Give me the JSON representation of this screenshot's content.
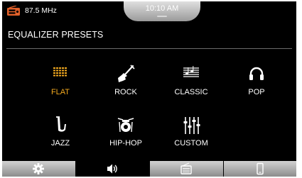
{
  "status": {
    "frequency": "87.5 MHz",
    "time": "10:10 AM",
    "radio_icon": "radio-icon"
  },
  "page": {
    "title": "EQUALIZER PRESETS"
  },
  "presets": [
    {
      "label": "FLAT",
      "icon": "equalizer-bars-icon",
      "selected": true
    },
    {
      "label": "ROCK",
      "icon": "electric-guitar-icon",
      "selected": false
    },
    {
      "label": "CLASSIC",
      "icon": "sheet-music-icon",
      "selected": false
    },
    {
      "label": "POP",
      "icon": "headphones-icon",
      "selected": false
    },
    {
      "label": "JAZZ",
      "icon": "saxophone-icon",
      "selected": false
    },
    {
      "label": "HIP-HOP",
      "icon": "drum-kit-icon",
      "selected": false
    },
    {
      "label": "CUSTOM",
      "icon": "sliders-icon",
      "selected": false
    }
  ],
  "bottom_nav": [
    {
      "icon": "gear-icon"
    },
    {
      "icon": "speaker-icon"
    },
    {
      "icon": "radio-icon"
    },
    {
      "icon": "phone-icon"
    }
  ],
  "colors": {
    "accent": "#f2a91f",
    "radio_icon": "#e2612a",
    "background": "#000000",
    "text": "#ffffff"
  }
}
